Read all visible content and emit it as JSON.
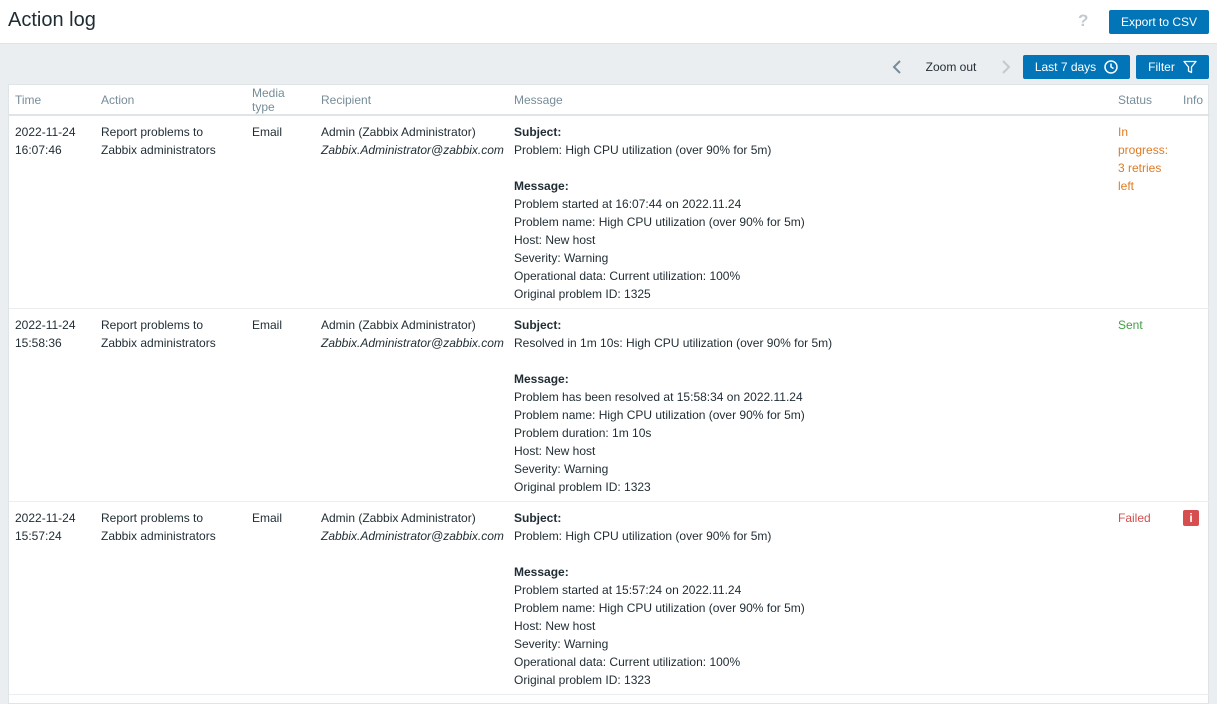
{
  "header": {
    "title": "Action log",
    "help_symbol": "?",
    "export_label": "Export to CSV"
  },
  "toolbar": {
    "zoom_label": "Zoom out",
    "period_label": "Last 7 days",
    "filter_label": "Filter"
  },
  "table": {
    "columns": [
      "Time",
      "Action",
      "Media type",
      "Recipient",
      "Message",
      "Status",
      "Info"
    ],
    "rows": [
      {
        "date": "2022-11-24",
        "time": "16:07:46",
        "action_line1": "Report problems to",
        "action_line2": "Zabbix administrators",
        "media_type": "Email",
        "recipient_name": "Admin (Zabbix Administrator)",
        "recipient_email": "Zabbix.Administrator@zabbix.com",
        "subject_label": "Subject:",
        "subject": "Problem: High CPU utilization (over 90% for 5m)",
        "message_label": "Message:",
        "message_lines": [
          "Problem started at 16:07:44 on 2022.11.24",
          "Problem name: High CPU utilization (over 90% for 5m)",
          "Host: New host",
          "Severity: Warning",
          "Operational data: Current utilization: 100%",
          "Original problem ID: 1325"
        ],
        "status": "In progress: 3 retries left"
      },
      {
        "date": "2022-11-24",
        "time": "15:58:36",
        "action_line1": "Report problems to",
        "action_line2": "Zabbix administrators",
        "media_type": "Email",
        "recipient_name": "Admin (Zabbix Administrator)",
        "recipient_email": "Zabbix.Administrator@zabbix.com",
        "subject_label": "Subject:",
        "subject": "Resolved in 1m 10s: High CPU utilization (over 90% for 5m)",
        "message_label": "Message:",
        "message_lines": [
          "Problem has been resolved at 15:58:34 on 2022.11.24",
          "Problem name: High CPU utilization (over 90% for 5m)",
          "Problem duration: 1m 10s",
          "Host: New host",
          "Severity: Warning",
          "Original problem ID: 1323"
        ],
        "status": "Sent"
      },
      {
        "date": "2022-11-24",
        "time": "15:57:24",
        "action_line1": "Report problems to",
        "action_line2": "Zabbix administrators",
        "media_type": "Email",
        "recipient_name": "Admin (Zabbix Administrator)",
        "recipient_email": "Zabbix.Administrator@zabbix.com",
        "subject_label": "Subject:",
        "subject": "Problem: High CPU utilization (over 90% for 5m)",
        "message_label": "Message:",
        "message_lines": [
          "Problem started at 15:57:24 on 2022.11.24",
          "Problem name: High CPU utilization (over 90% for 5m)",
          "Host: New host",
          "Severity: Warning",
          "Operational data: Current utilization: 100%",
          "Original problem ID: 1323"
        ],
        "status": "Failed",
        "info_icon_glyph": "i"
      }
    ]
  },
  "colors": {
    "primary": "#0275b8",
    "in_progress": "#e07b23",
    "sent": "#429e47",
    "failed": "#d64e4e"
  },
  "icons": {
    "help": "help-icon",
    "prev": "chevron-left-icon",
    "next": "chevron-right-icon",
    "clock": "clock-icon",
    "filter": "filter-icon",
    "info": "info-icon"
  }
}
